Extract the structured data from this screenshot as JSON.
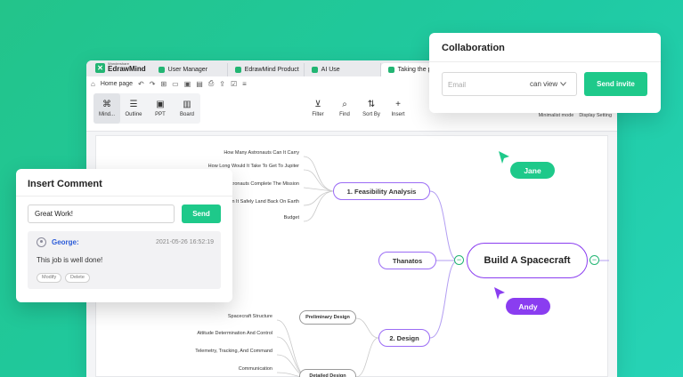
{
  "app": {
    "brand_small": "Wondershare",
    "brand_name": "EdrawMind",
    "tabs": [
      {
        "label": "User Manager"
      },
      {
        "label": "EdrawMind Product"
      },
      {
        "label": "AI Use"
      },
      {
        "label": "Taking the p"
      }
    ],
    "menubar": {
      "home": "Home page"
    },
    "views": [
      {
        "label": "Mind..."
      },
      {
        "label": "Outline"
      },
      {
        "label": "PPT"
      },
      {
        "label": "Board"
      }
    ],
    "tools": [
      {
        "label": "Filter"
      },
      {
        "label": "Find"
      },
      {
        "label": "Sort By"
      },
      {
        "label": "Insert"
      }
    ],
    "right_links": {
      "minimalist": "Minimalist mode",
      "display": "Display Setting"
    }
  },
  "mindmap": {
    "root": "Build A Spacecraft",
    "branch1": {
      "label": "1. Feasibility Analysis",
      "leaves": [
        "How Many Astronauts Can It Carry",
        "How Long Would It Take To Get To Jupiter",
        "...Astronauts Complete The Mission",
        "...n It Safely Land Back On Earth",
        "Budget"
      ]
    },
    "branch_thanatos": "Thanatos",
    "branch2": {
      "label": "2. Design",
      "sub1": "Preliminary Design",
      "sub2": "Detailed Design",
      "leaves": [
        "Spacecraft Structure",
        "Attitude Determination And Control",
        "Telemetry, Tracking, And Command",
        "Communication"
      ]
    }
  },
  "cursors": {
    "jane": {
      "name": "Jane",
      "color": "#1ec98a"
    },
    "andy": {
      "name": "Andy",
      "color": "#8a3df0"
    }
  },
  "collaboration": {
    "title": "Collaboration",
    "email_placeholder": "Email",
    "permission": "can view",
    "send_label": "Send invite"
  },
  "comment": {
    "title": "Insert Comment",
    "input_value": "Great Work!",
    "send_label": "Send",
    "entry": {
      "author": "George:",
      "time": "2021-05-26 16:52:19",
      "text": "This job is well done!",
      "modify": "Modify",
      "delete": "Delete"
    }
  },
  "colors": {
    "accent_green": "#1ec98a",
    "accent_purple": "#8a3df0"
  }
}
